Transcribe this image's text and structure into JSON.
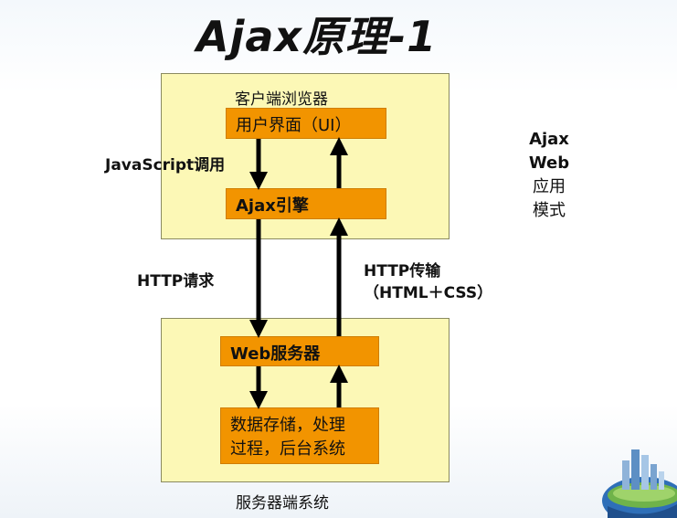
{
  "title": "Ajax原理-1",
  "client": {
    "label": "客户端浏览器",
    "ui_box": "用户界面（UI）",
    "engine_box": "Ajax引擎"
  },
  "server": {
    "label": "服务器端系统",
    "web_box": "Web服务器",
    "data_box": [
      "数据存储，处理",
      "过程，后台系统"
    ]
  },
  "labels": {
    "js_call": "JavaScript调用",
    "http_request": "HTTP请求",
    "http_transfer": "HTTP传输",
    "http_formats": "（HTML＋CSS）"
  },
  "side_text": {
    "line1": "Ajax",
    "line2": "Web",
    "line3": "应用",
    "line4": "模式"
  },
  "colors": {
    "panel": "#fcf8b6",
    "box": "#f29400",
    "arrow": "#000000"
  }
}
